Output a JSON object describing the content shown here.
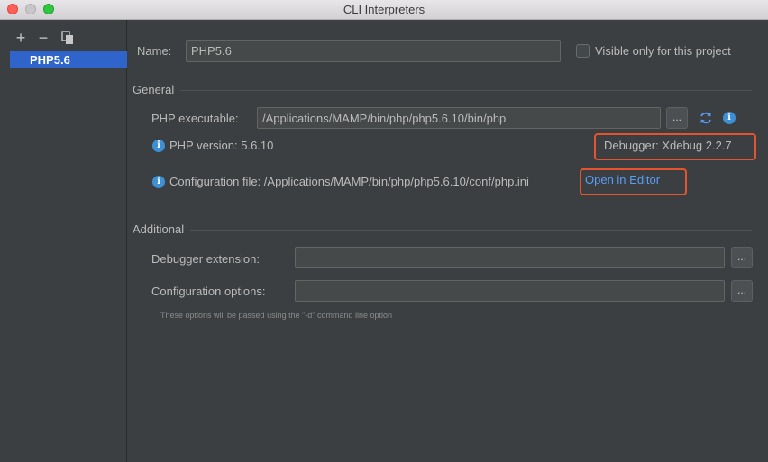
{
  "window": {
    "title": "CLI Interpreters"
  },
  "toolbar": {
    "add_label": "+",
    "remove_label": "−"
  },
  "interpreters": [
    {
      "name": "PHP5.6",
      "selected": true
    }
  ],
  "form": {
    "name_label": "Name:",
    "name_value": "PHP5.6",
    "visible_only_label": "Visible only for this project",
    "visible_only_checked": false
  },
  "general": {
    "title": "General",
    "php_executable_label": "PHP executable:",
    "php_executable_value": "/Applications/MAMP/bin/php/php5.6.10/bin/php",
    "browse_label": "...",
    "php_version_text": "PHP version: 5.6.10",
    "debugger_text": "Debugger: Xdebug 2.2.7",
    "config_file_text": "Configuration file: /Applications/MAMP/bin/php/php5.6.10/conf/php.ini",
    "open_in_editor_label": "Open in Editor"
  },
  "additional": {
    "title": "Additional",
    "debugger_extension_label": "Debugger extension:",
    "debugger_extension_value": "",
    "configuration_options_label": "Configuration options:",
    "configuration_options_value": "",
    "browse_label": "...",
    "hint": "These options will be passed using the \"-d\" command line option"
  },
  "colors": {
    "background": "#3c3f41",
    "selection": "#2f65ca",
    "link": "#589df6",
    "highlight": "#e5532f",
    "info_icon": "#3d8fd6"
  },
  "icons": [
    "close-icon",
    "minimize-icon",
    "maximize-icon",
    "add-icon",
    "remove-icon",
    "copy-icon",
    "refresh-icon",
    "info-icon"
  ]
}
